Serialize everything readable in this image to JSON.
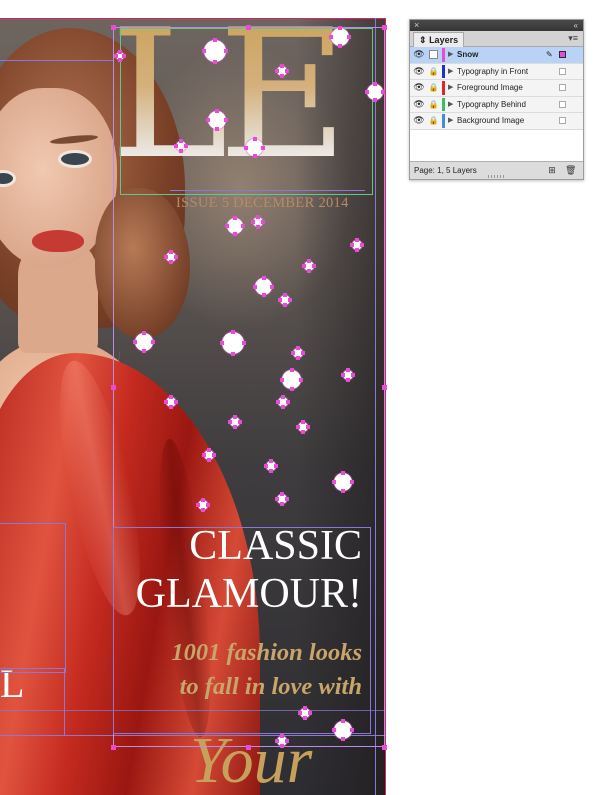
{
  "document": {
    "masthead": "LE",
    "issue_line": "ISSUE 5 DECEMBER 2014",
    "headline_line1": "CLASSIC",
    "headline_line2": "GLAMOUR!",
    "tagline_line1": "1001 fashion looks",
    "tagline_line2": "to fall in love with",
    "word_your": "Your",
    "cut_letter": "L"
  },
  "layers_panel": {
    "close_glyph": "×",
    "collapse_glyph": "«",
    "tab_label": "Layers",
    "menu_glyph": "▾≡",
    "status": "Page: 1, 5 Layers",
    "new_layer_glyph": "⊞",
    "delete_layer_glyph": "🗑",
    "layers": [
      {
        "name": "Snow",
        "color": "#e94bd8",
        "selected": true,
        "locked": false
      },
      {
        "name": "Typography in Front",
        "color": "#1f2fd1",
        "selected": false,
        "locked": true
      },
      {
        "name": "Foreground Image",
        "color": "#e0262d",
        "selected": false,
        "locked": true
      },
      {
        "name": "Typography Behind",
        "color": "#36c25a",
        "selected": false,
        "locked": true
      },
      {
        "name": "Background Image",
        "color": "#3d8fe0",
        "selected": false,
        "locked": true
      }
    ]
  },
  "colors": {
    "accent_gold": "#c7a05c",
    "selection_magenta": "#e94bd8",
    "guide_purple": "#8a78d6"
  }
}
